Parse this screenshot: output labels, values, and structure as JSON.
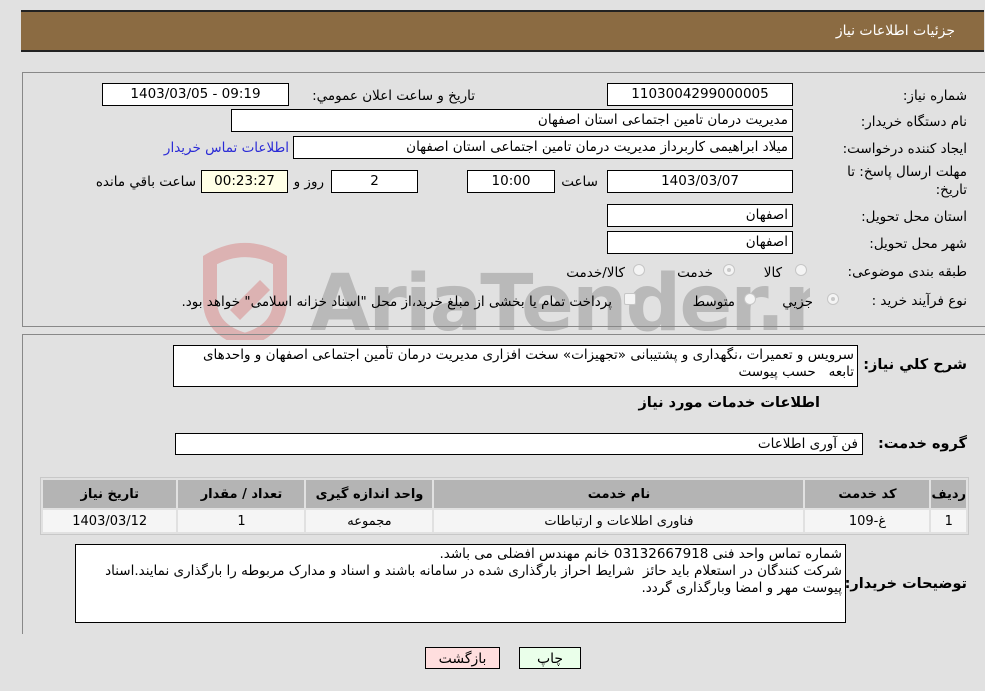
{
  "header": {
    "title": "جزئيات اطلاعات نياز"
  },
  "form": {
    "need_number": {
      "label": "شماره نیاز:",
      "value": "1103004299000005"
    },
    "announce_datetime": {
      "label": "تاريخ و ساعت اعلان عمومي:",
      "value": "1403/03/05 - 09:19"
    },
    "buyer_org": {
      "label": "نام دستگاه خریدار:",
      "value": "مدیریت درمان تامین اجتماعی استان اصفهان"
    },
    "creator": {
      "label": "ایجاد کننده درخواست:",
      "value": "میلاد ابراهیمی کاربرداز مدیریت درمان تامین اجتماعی استان اصفهان"
    },
    "buyer_contact_link": "اطلاعات تماس خریدار",
    "deadline": {
      "label_line1": "مهلت ارسال پاسخ: تا",
      "label_line2": "تاریخ:",
      "date": "1403/03/07",
      "time_label": "ساعت",
      "time": "10:00",
      "days": "2",
      "days_label": "روز و",
      "remaining": "00:23:27",
      "remaining_label": "ساعت باقي مانده"
    },
    "delivery_province": {
      "label": "استان محل تحویل:",
      "value": "اصفهان"
    },
    "delivery_city": {
      "label": "شهر محل تحویل:",
      "value": "اصفهان"
    },
    "category": {
      "label": "طبقه بندی موضوعی:",
      "options": [
        "کالا",
        "خدمت",
        "کالا/خدمت"
      ],
      "selected": "خدمت"
    },
    "purchase_type": {
      "label": "نوع فرآیند خرید :",
      "options": [
        "جزيي",
        "متوسط"
      ],
      "selected": "جزيي",
      "treasury_note": "پرداخت تمام یا بخشی از مبلغ خرید،از محل \"اسناد خزانه اسلامی\" خواهد بود.",
      "treasury_checked": false
    }
  },
  "description": {
    "label": "شرح كلي نياز:",
    "value": "سرویس و تعمیرات ،نگهداری و پشتیبانی «تجهیزات» سخت افزاری مدیریت درمان تأمین اجتماعی اصفهان و واحدهای تابعه   حسب پیوست"
  },
  "services_section": {
    "title": "اطلاعات خدمات مورد نیاز",
    "group_label": "گروه خدمت:",
    "group_value": "فن آوری اطلاعات",
    "table": {
      "headers": [
        "ردیف",
        "کد خدمت",
        "نام خدمت",
        "واحد اندازه گیری",
        "تعداد / مقدار",
        "تاریخ نیاز"
      ],
      "rows": [
        [
          "1",
          "غ-109",
          "فناوری اطلاعات و ارتباطات",
          "مجموعه",
          "1",
          "1403/03/12"
        ]
      ]
    }
  },
  "buyer_notes": {
    "label": "توضیحات خریدار:",
    "value": "شماره تماس واحد فنی 03132667918 خانم مهندس افضلی می باشد.\nشرکت کنندگان در استعلام باید حائز  شرایط احراز بارگذاری شده در سامانه باشند و اسناد و مدارک مربوطه را بارگذاری نمایند.اسناد پیوست مهر و امضا وبارگذاری گردد."
  },
  "buttons": {
    "print": "چاپ",
    "back": "بازگشت"
  },
  "watermark": {
    "text": "AriaTender.neT"
  },
  "colors": {
    "header": "#8b6b42",
    "link": "#2b2bd6",
    "print_bg": "#eaffea",
    "back_bg": "#ffdede",
    "remaining_bg": "#ffffe6"
  }
}
